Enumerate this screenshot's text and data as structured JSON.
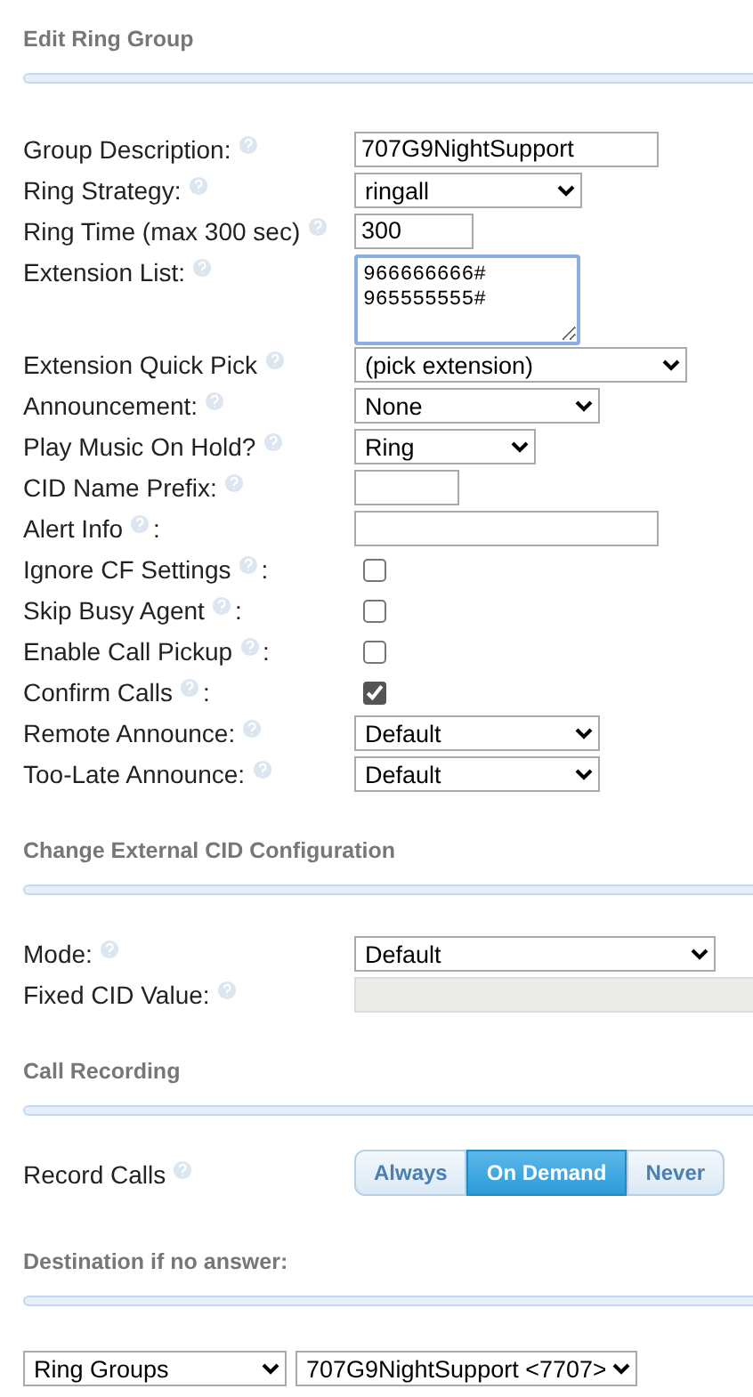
{
  "sections": [
    {
      "title": "Edit Ring Group",
      "fields": [
        {
          "kind": "text",
          "label": "Group Description:",
          "value": "707G9NightSupport"
        },
        {
          "kind": "select",
          "label": "Ring Strategy:",
          "value": "ringall"
        },
        {
          "kind": "number",
          "label": "Ring Time (max 300 sec)",
          "value": "300"
        },
        {
          "kind": "textarea",
          "label": "Extension List:",
          "value": "966666666#\n965555555#"
        },
        {
          "kind": "select",
          "label": "Extension Quick Pick",
          "value": "(pick extension)"
        },
        {
          "kind": "select",
          "label": "Announcement:",
          "value": "None"
        },
        {
          "kind": "select",
          "label": "Play Music On Hold?",
          "value": "Ring"
        },
        {
          "kind": "text",
          "label": "CID Name Prefix:"
        },
        {
          "kind": "text",
          "label": "Alert Info",
          "suffix": ":"
        },
        {
          "kind": "checkbox",
          "label": "Ignore CF Settings",
          "suffix": ":",
          "checked": false
        },
        {
          "kind": "checkbox",
          "label": "Skip Busy Agent",
          "suffix": ":",
          "checked": false
        },
        {
          "kind": "checkbox",
          "label": "Enable Call Pickup",
          "suffix": ":",
          "checked": false
        },
        {
          "kind": "checkbox",
          "label": "Confirm Calls",
          "suffix": ":",
          "checked": true
        },
        {
          "kind": "select",
          "label": "Remote Announce:",
          "value": "Default"
        },
        {
          "kind": "select",
          "label": "Too-Late Announce:",
          "value": "Default"
        }
      ]
    },
    {
      "title": "Change External CID Configuration",
      "fields": [
        {
          "kind": "select",
          "label": "Mode:",
          "value": "Default"
        },
        {
          "kind": "readonly",
          "label": "Fixed CID Value:"
        }
      ]
    },
    {
      "title": "Call Recording",
      "fields": [
        {
          "kind": "radio",
          "label": "Record Calls",
          "options": [
            {
              "label": "Always",
              "selected": false
            },
            {
              "label": "On Demand",
              "selected": true
            },
            {
              "label": "Never",
              "selected": false
            }
          ]
        }
      ]
    },
    {
      "title": "Destination if no answer:",
      "fields": [
        {
          "kind": "destination",
          "selects": [
            "Ring Groups",
            "707G9NightSupport <7707>"
          ]
        }
      ]
    }
  ]
}
